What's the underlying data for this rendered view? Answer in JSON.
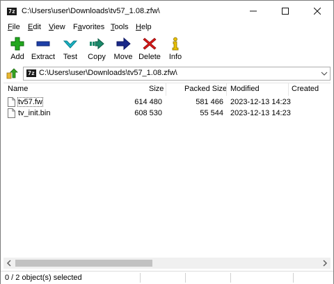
{
  "window": {
    "title": "C:\\Users\\user\\Downloads\\tv57_1.08.zfw\\",
    "app_icon_text": "7z"
  },
  "menu": [
    {
      "label": "File",
      "mnemonic": "F",
      "rest": "ile"
    },
    {
      "label": "Edit",
      "mnemonic": "E",
      "rest": "dit"
    },
    {
      "label": "View",
      "mnemonic": "V",
      "rest": "iew"
    },
    {
      "label": "Favorites",
      "mnemonic": "a",
      "pre": "F",
      "rest": "vorites"
    },
    {
      "label": "Tools",
      "mnemonic": "T",
      "rest": "ools"
    },
    {
      "label": "Help",
      "mnemonic": "H",
      "rest": "elp"
    }
  ],
  "toolbar": {
    "add": "Add",
    "extract": "Extract",
    "test": "Test",
    "copy": "Copy",
    "move": "Move",
    "delete": "Delete",
    "info": "Info"
  },
  "address": {
    "path": "C:\\Users\\user\\Downloads\\tv57_1.08.zfw\\",
    "icon_text": "7z"
  },
  "columns": {
    "name": "Name",
    "size": "Size",
    "packed": "Packed Size",
    "modified": "Modified",
    "created": "Created"
  },
  "files": [
    {
      "name": "tv57.fw",
      "size": "614 480",
      "packed": "581 466",
      "modified": "2023-12-13 14:23"
    },
    {
      "name": "tv_init.bin",
      "size": "608 530",
      "packed": "55 544",
      "modified": "2023-12-13 14:23"
    }
  ],
  "status": {
    "selection": "0 / 2 object(s) selected"
  },
  "colors": {
    "add_green": "#22a81e",
    "extract_blue": "#1e3fa8",
    "test_cyan": "#1bb3c4",
    "copy_teal": "#1a8a6a",
    "move_navy": "#1a2a8a",
    "delete_red": "#d81818",
    "info_yellow": "#e8c000"
  }
}
